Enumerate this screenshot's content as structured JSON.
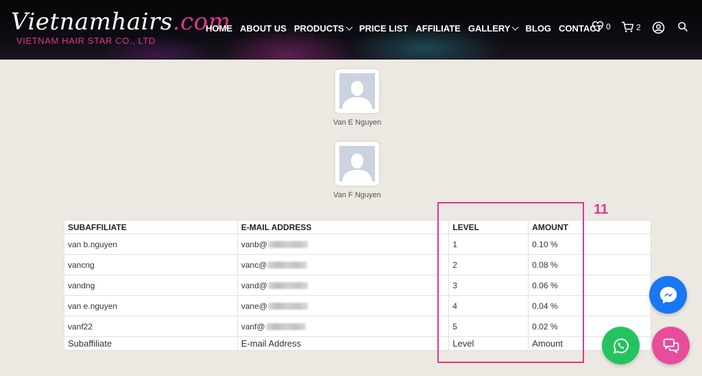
{
  "header": {
    "logo_main": "Vietnamhairs",
    "logo_dot": ".com",
    "logo_sub": "VIETNAM HAIR STAR CO., LTD",
    "nav": [
      {
        "label": "HOME"
      },
      {
        "label": "ABOUT US"
      },
      {
        "label": "PRODUCTS",
        "dropdown": true
      },
      {
        "label": "PRICE LIST"
      },
      {
        "label": "AFFILIATE"
      },
      {
        "label": "GALLERY",
        "dropdown": true
      },
      {
        "label": "BLOG"
      },
      {
        "label": "CONTACT"
      }
    ],
    "wishlist_count": "0",
    "cart_count": "2"
  },
  "profiles": [
    {
      "name": "Van E Nguyen"
    },
    {
      "name": "Van F Nguyen"
    }
  ],
  "table": {
    "headers": [
      "SUBAFFILIATE",
      "E-MAIL ADDRESS",
      "LEVEL",
      "AMOUNT"
    ],
    "rows": [
      {
        "subaffiliate": "van b.nguyen",
        "email_prefix": "vanb@",
        "level": "1",
        "amount": "0.10 %"
      },
      {
        "subaffiliate": "vancng",
        "email_prefix": "vanc@",
        "level": "2",
        "amount": "0.08 %"
      },
      {
        "subaffiliate": "vandng",
        "email_prefix": "vand@",
        "level": "3",
        "amount": "0.06 %"
      },
      {
        "subaffiliate": "van e.nguyen",
        "email_prefix": "vane@",
        "level": "4",
        "amount": "0.04 %"
      },
      {
        "subaffiliate": "vanf22",
        "email_prefix": "vanf@",
        "level": "5",
        "amount": "0.02 %"
      }
    ],
    "footer": [
      "Subaffiliate",
      "E-mail Address",
      "Level",
      "Amount"
    ]
  },
  "annotation": {
    "label": "11",
    "color": "#e0358f"
  },
  "colors": {
    "accent": "#e0358f",
    "messenger": "#1877f2",
    "whatsapp": "#25c35f",
    "chat": "#e84c9c"
  }
}
